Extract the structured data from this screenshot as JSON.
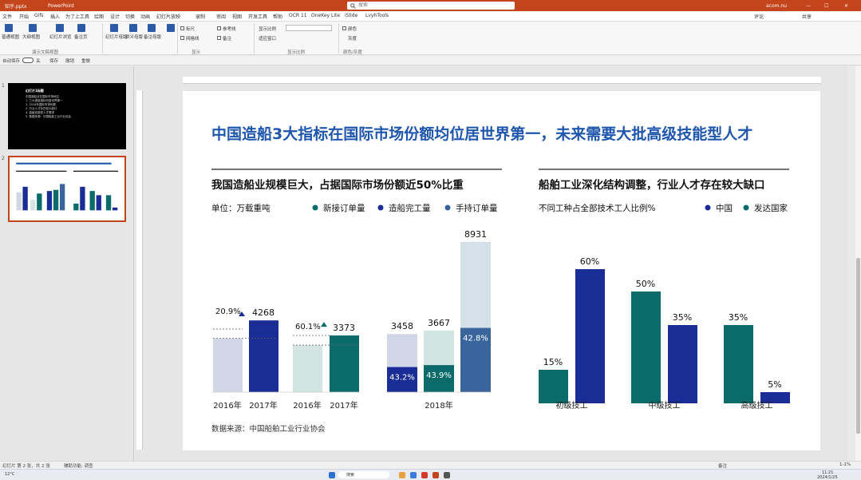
{
  "window": {
    "filename": "知乎.pptx",
    "app": "PowerPoint",
    "search_placeholder": "搜索",
    "user": "acom.nu",
    "win_controls": [
      "—",
      "☐",
      "✕"
    ]
  },
  "menu": {
    "items": [
      "文件",
      "开始",
      "Gifs",
      "插入",
      "为了上工具",
      "绘图",
      "设计",
      "切换",
      "动画",
      "幻灯片放映",
      "录制",
      "审阅",
      "视图",
      "开发工具",
      "帮助",
      "OCR 11",
      "OneKey Lite",
      "iSlide",
      "LvyhTools"
    ],
    "right_items": [
      "评论",
      "共享"
    ]
  },
  "ribbon": {
    "buttons": [
      "普通视图",
      "大纲视图",
      "幻灯片浏览",
      "备注页",
      "阅读视图",
      "幻灯片母版",
      "讲义母版",
      "备注母版",
      "标尺",
      "网格线",
      "参考线",
      "显示比例",
      "适应窗口",
      "颜色",
      "灰度",
      "黑白模式",
      "新建窗口",
      "全部重排",
      "层叠窗口",
      "移动拆分",
      "切换窗口",
      "宏"
    ],
    "checkboxes": [
      "标尺",
      "网格线",
      "参考线",
      "备注"
    ],
    "groups": [
      "演示文稿视图",
      "母版视图",
      "显示",
      "显示比例",
      "颜色/灰度",
      "窗口",
      "宏"
    ]
  },
  "quick_toolbar": {
    "items": [
      "自动保存",
      "关",
      "保存",
      "撤销",
      "重做"
    ]
  },
  "status": {
    "slide_info": "幻灯片 第 2 张，共 2 张",
    "accessibility": "辅助功能: 调查",
    "notes": "备注",
    "zoom": "100%",
    "zoom_short": "1-1%"
  },
  "taskbar": {
    "weather": "12°C",
    "search_label": "搜索",
    "time": "11:21",
    "date": "2024/1/25"
  },
  "thumb1": {
    "title": "幻灯片1标题",
    "lines": [
      "中国造船业在国际市场地位",
      "1. 三大造船指标均居世界第一",
      "2. 2018年国际市场份额",
      "3. 行业人才存在较大缺口",
      "4. 高级技能型人才需求",
      "5. 数据来源：中国船舶工业行业协会"
    ]
  },
  "slide": {
    "title": "中国造船3大指标在国际市场份额均位居世界第一，未来需要大批高级技能型人才",
    "left_panel_title": "我国造船业规模巨大，占据国际市场份额近50%比重",
    "unit_label": "单位：万载重吨",
    "legend_left": [
      "新接订单量",
      "造船完工量",
      "手持订单量"
    ],
    "right_panel_title": "船舶工业深化结构调整，行业人才存在较大缺口",
    "right_subtitle": "不同工种占全部技术工人比例%",
    "legend_right": [
      "中国",
      "发达国家"
    ],
    "source": "数据来源：中国船舶工业行业协会"
  },
  "colors": {
    "navy": "#1a2c96",
    "teal": "#0b6b6a",
    "lavender": "#d1d7e7",
    "mint": "#d3e5e2",
    "lightblue": "#d5e1e9",
    "steel": "#3a649c",
    "title_blue": "#1e56ad"
  },
  "chart_data": [
    {
      "type": "bar",
      "title": "我国造船业规模巨大，占据国际市场份额近50%比重",
      "ylabel": "单位：万载重吨",
      "categories": [
        "2016年",
        "2017年",
        "2016年",
        "2017年"
      ],
      "series": [
        {
          "name": "新接订单量",
          "values": [
            null,
            4268,
            null,
            null
          ],
          "share_2016": "20.9%"
        },
        {
          "name": "造船完工量",
          "values": [
            null,
            null,
            null,
            3373
          ],
          "share_2016": "60.1%"
        }
      ],
      "value_labels": [
        "4268",
        "3373"
      ],
      "share_labels": [
        "20.9%",
        "60.1%"
      ]
    },
    {
      "type": "bar",
      "categories": [
        "2018年"
      ],
      "series": [
        {
          "name": "新接订单量",
          "total": 3458,
          "share": "43.2%"
        },
        {
          "name": "造船完工量",
          "total": 3667,
          "share": "43.9%"
        },
        {
          "name": "手持订单量",
          "total": 8931,
          "share": "42.8%"
        }
      ],
      "value_labels": [
        "3458",
        "3667",
        "8931"
      ],
      "share_labels": [
        "43.2%",
        "43.9%",
        "42.8%"
      ]
    },
    {
      "type": "bar",
      "title": "船舶工业深化结构调整，行业人才存在较大缺口",
      "ylabel": "不同工种占全部技术工人比例%",
      "categories": [
        "初级技工",
        "中级技工",
        "高级技工"
      ],
      "series": [
        {
          "name": "中国",
          "values": [
            60,
            35,
            5
          ]
        },
        {
          "name": "发达国家",
          "values": [
            15,
            50,
            35
          ]
        }
      ],
      "value_labels": [
        "15%",
        "60%",
        "50%",
        "35%",
        "35%",
        "5%"
      ]
    }
  ]
}
